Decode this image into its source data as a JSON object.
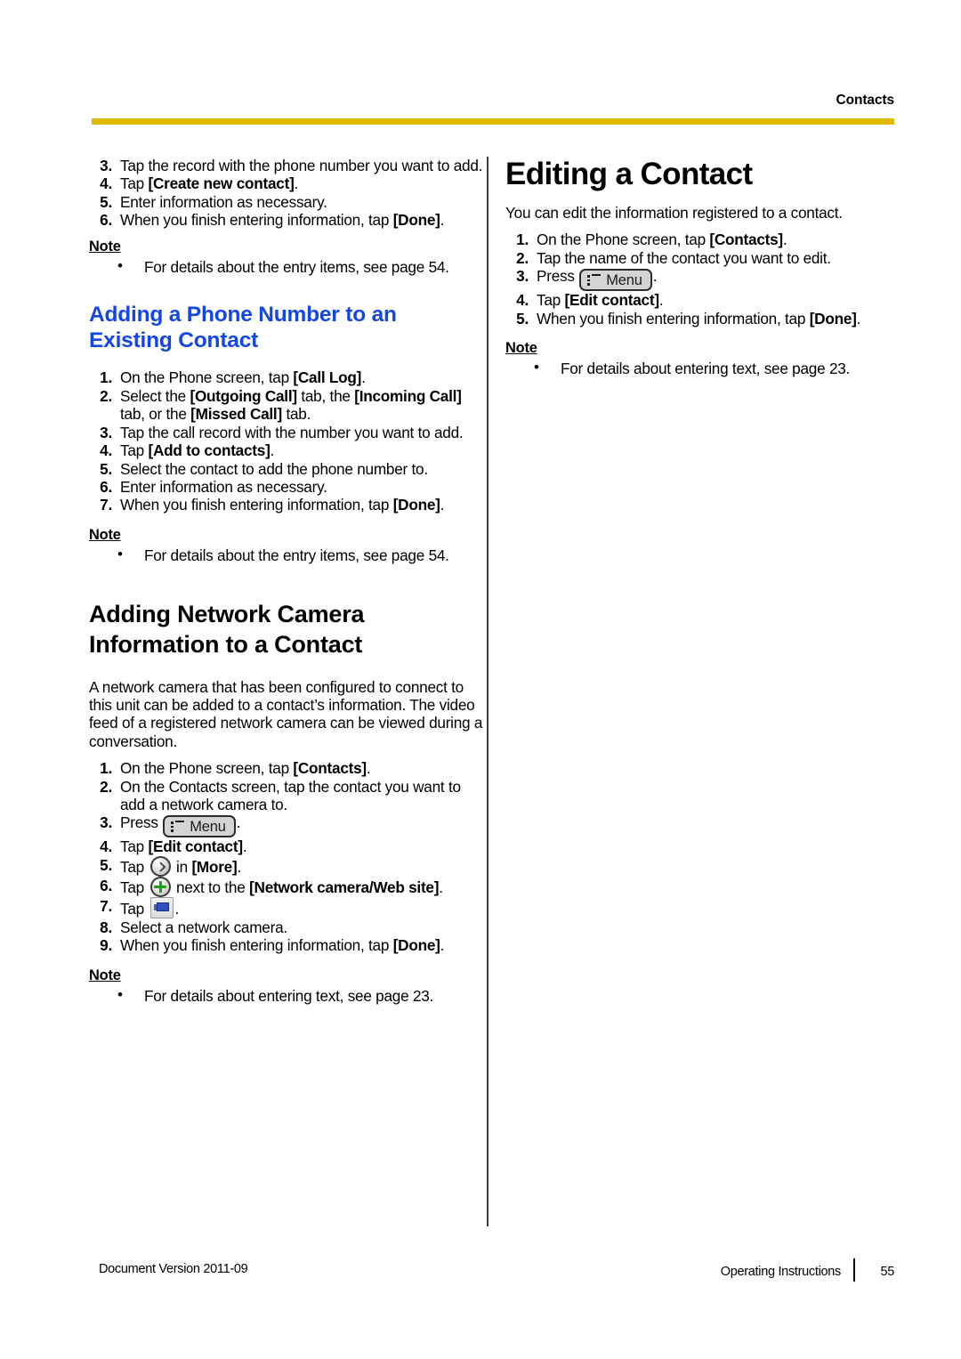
{
  "header": {
    "section_title": "Contacts",
    "rule_color": "#DDBA00"
  },
  "left_column": {
    "continued_steps": [
      {
        "num": "3.",
        "text": "Tap the record with the phone number you want to add."
      },
      {
        "num": "4.",
        "text": "Tap [Create new contact]."
      },
      {
        "num": "5.",
        "text": "Enter information as necessary."
      },
      {
        "num": "6.",
        "text": "When you finish entering information, tap [Done]."
      }
    ],
    "note1": {
      "label": "Note",
      "bullet": "•",
      "items": [
        "For details about the entry items, see page 54."
      ]
    },
    "heading_phone": "Adding a Phone Number to an Existing Contact",
    "heading_phone_color": "#1446E6",
    "phone_steps": [
      {
        "num": "1.",
        "text": "On the Phone screen, tap [Call Log]."
      },
      {
        "num": "2.",
        "text": "Select the [Outgoing Call] tab, the [Incoming Call] tab, or the [Missed Call] tab."
      },
      {
        "num": "3.",
        "text": "Tap the call record with the number you want to add."
      },
      {
        "num": "4.",
        "text": "Tap [Add to contacts]."
      },
      {
        "num": "5.",
        "text": "Select the contact to add the phone number to."
      },
      {
        "num": "6.",
        "text": "Enter information as necessary."
      },
      {
        "num": "7.",
        "text": "When you finish entering information, tap [Done]."
      }
    ],
    "note2": {
      "label": "Note",
      "bullet": "•",
      "items": [
        "For details about the entry items, see page 54."
      ]
    },
    "heading_camera": "Adding Network Camera Information to a Contact",
    "camera_intro": "A network camera that has been configured to connect to this unit can be added to a contact’s information. The video feed of a registered network camera can be viewed during a conversation.",
    "camera_steps": [
      {
        "num": "1.",
        "text": "On the Phone screen, tap [Contacts]."
      },
      {
        "num": "2.",
        "text": "On the Contacts screen, tap the contact you want to add a network camera to."
      },
      {
        "num": "3.",
        "prefix": "Press ",
        "key": "Menu",
        "suffix": "."
      },
      {
        "num": "4.",
        "text": "Tap [Edit contact]."
      },
      {
        "num": "5.",
        "prefix": "Tap ",
        "icon": "chevron-right-icon",
        "suffix": " in [More]."
      },
      {
        "num": "6.",
        "prefix": "Tap ",
        "icon": "add-plus-icon",
        "suffix": " next to the [Network camera/Web site]."
      },
      {
        "num": "7.",
        "prefix": "Tap ",
        "icon": "network-camera-icon",
        "suffix": "."
      },
      {
        "num": "8.",
        "text": "Select a network camera."
      },
      {
        "num": "9.",
        "text": "When you finish entering information, tap [Done]."
      }
    ],
    "note3": {
      "label": "Note",
      "bullet": "•",
      "items": [
        "For details about entering text, see page 23."
      ]
    }
  },
  "right_column": {
    "heading": "Editing a Contact",
    "intro": "You can edit the information registered to a contact.",
    "steps": [
      {
        "num": "1.",
        "text": "On the Phone screen, tap [Contacts]."
      },
      {
        "num": "2.",
        "text": "Tap the name of the contact you want to edit."
      },
      {
        "num": "3.",
        "prefix": "Press ",
        "key": "Menu",
        "suffix": "."
      },
      {
        "num": "4.",
        "text": "Tap [Edit contact]."
      },
      {
        "num": "5.",
        "text": "When you finish entering information, tap [Done]."
      }
    ],
    "note": {
      "label": "Note",
      "bullet": "•",
      "items": [
        "For details about entering text, see page 23."
      ]
    }
  },
  "footer": {
    "doc_version": "Document Version  2011-09",
    "manual_name": "Operating Instructions",
    "page_number": "55"
  }
}
